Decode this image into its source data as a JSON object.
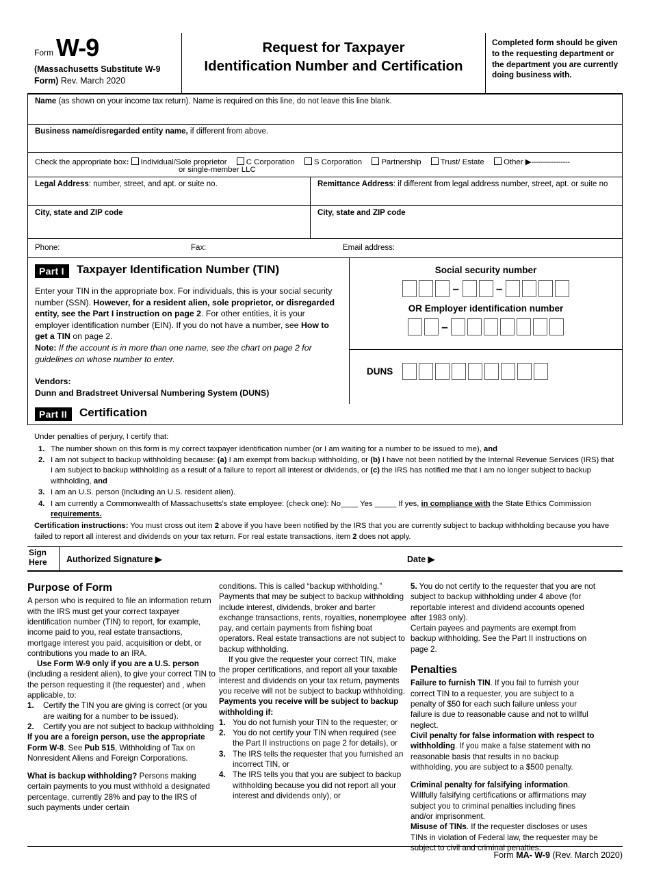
{
  "header": {
    "form_label": "Form",
    "form_number": "W-9",
    "substitute_line1": "(Massachusetts Substitute W-9",
    "substitute_line2_bold": "Form)",
    "substitute_line2_rest": " Rev. March 2020",
    "title_line1": "Request for Taxpayer",
    "title_line2": "Identification Number and Certification",
    "notice": "Completed form should be given to the requesting department or the department you are currently doing business with."
  },
  "fields": {
    "name_label_bold": "Name",
    "name_label_rest": " (as shown on your income tax return). Name is required on this line, do not leave this line blank.",
    "business_label_bold": "Business name/disregarded entity name,",
    "business_label_rest": " if different from above.",
    "checkbox_prompt": "Check the appropriate box",
    "checkbox_colon": ":",
    "options": [
      "Individual/Sole proprietor",
      "C Corporation",
      "S Corporation",
      "Partnership",
      "Trust/ Estate",
      "Other"
    ],
    "option_sub": "or single-member LLC",
    "other_arrow": "▶",
    "other_dashes": "-----------------",
    "legal_address_bold": "Legal Address",
    "legal_address_rest": ": number, street, and apt. or suite no.",
    "remittance_address_bold": "Remittance Address",
    "remittance_address_rest": ": if different from legal address number, street, apt. or suite no",
    "city_state_zip": "City, state and ZIP code",
    "phone": "Phone:",
    "fax": "Fax:",
    "email": "Email address:"
  },
  "part1": {
    "badge": "Part I",
    "heading": "Taxpayer Identification Number (TIN)",
    "p_a": "Enter your TIN in the appropriate box.  For individuals, this is your social security number (SSN).  ",
    "p_b_bold": "However, for a resident alien, sole proprietor, or disregarded entity, see the Part I instruction on page 2",
    "p_c": ".  For other entities, it is your employer identification number (EIN). If you do not have a number, see ",
    "p_d_bold": "How to get a TIN",
    "p_e": " on page 2.",
    "note_bold": "Note:",
    "note_italic": " If the account is in more than one name, see the chart on page 2 for guidelines on whose number to enter.",
    "vendors_line1": "Vendors:",
    "vendors_line2": "Dunn and Bradstreet Universal Numbering System (DUNS)",
    "ssn_label": "Social security number",
    "ein_label": "OR Employer identification number",
    "duns_label": "DUNS",
    "ssn_groups": [
      3,
      2,
      4
    ],
    "ein_groups": [
      2,
      7
    ],
    "duns_boxes": 9,
    "separator": "–"
  },
  "part2": {
    "badge": "Part II",
    "heading": "Certification",
    "lead": "Under penalties of perjury, I certify that:",
    "items": [
      {
        "num": "1.",
        "segments": [
          {
            "t": "The number shown on this form is my correct taxpayer identification number (or I am waiting for a number to be issued to me), ",
            "s": "n"
          },
          {
            "t": "and",
            "s": "b"
          }
        ]
      },
      {
        "num": "2.",
        "segments": [
          {
            "t": "I am not subject to backup withholding because: ",
            "s": "n"
          },
          {
            "t": "(a)",
            "s": "b"
          },
          {
            "t": " I am exempt from backup withholding, or ",
            "s": "n"
          },
          {
            "t": "(b)",
            "s": "b"
          },
          {
            "t": " I have not been notified by the Internal Revenue Services (IRS) that I am subject to backup withholding as a result of a failure to report all interest or dividends, or ",
            "s": "n"
          },
          {
            "t": "(c)",
            "s": "b"
          },
          {
            "t": " the IRS has notified me that I am no longer subject to backup withholding, ",
            "s": "n"
          },
          {
            "t": "and",
            "s": "b"
          }
        ]
      },
      {
        "num": "3.",
        "segments": [
          {
            "t": "I am an U.S. person (including an U.S. resident alien).",
            "s": "n"
          }
        ]
      },
      {
        "num": "4.",
        "segments": [
          {
            "t": "I am currently a Commonwealth of Massachusetts's state employee: (check one):  No____ Yes _____ If yes, ",
            "s": "n"
          },
          {
            "t": "in compliance with",
            "s": "bu"
          },
          {
            "t": " the State Ethics Commission ",
            "s": "n"
          },
          {
            "t": "requirements.",
            "s": "bu"
          }
        ]
      }
    ],
    "instructions_bold": "Certification instructions:",
    "instructions_rest_1": "  You must cross out item ",
    "instructions_two": "2",
    "instructions_rest_2": " above if you have been notified by the IRS that you are currently subject to backup withholding because you have failed to report all interest and dividends on your tax return.  For real estate transactions, item ",
    "instructions_two_b": "2",
    "instructions_rest_3": " does not apply.",
    "sign_here_l1": "Sign",
    "sign_here_l2": "Here",
    "signature_label": "Authorized Signature ▶",
    "date_label": "Date ▶"
  },
  "instructions": {
    "col1": {
      "title": "Purpose of Form",
      "p1": "A person who is required to file an information return with the IRS must get your correct taxpayer identification number (TIN) to report, for example, income paid to you, real estate transactions, mortgage interest you paid, acquisition or debt, or contributions you made to an IRA.",
      "p2_bold": "Use Form W-9 only if you are a U.S. person",
      "p2_rest": " (including a resident alien), to give your correct TIN to the person requesting it (the requester) and , when applicable, to:",
      "list": [
        {
          "num": "1.",
          "text": "Certify the TIN you are giving is correct (or you are waiting for a number to be issued)."
        },
        {
          "num": "2.",
          "text": "Certify you are not subject to backup withholding"
        }
      ],
      "p3_bold": "If you are a foreign person, use the appropriate Form W-8",
      "p3_mid": ".  See ",
      "p3_bold2": "Pub 515",
      "p3_rest": ", Withholding of Tax on Nonresident Aliens and Foreign Corporations.",
      "p4_bold": "What is backup withholding?",
      "p4_rest": " Persons making certain payments to you must withhold a designated percentage, currently 28% and pay to the IRS of such payments under certain"
    },
    "col2": {
      "p1": "conditions.  This is called “backup withholding.” Payments that may be subject to backup withholding include interest, dividends, broker and barter exchange transactions, rents, royalties, nonemployee pay, and certain payments from fishing boat operators.  Real estate transactions are not subject to backup withholding.",
      "p2": "If you give the requester your correct TIN, make the proper certifications, and report all your taxable interest and dividends on your tax return, payments you receive will not be subject to backup withholding. ",
      "p2_bold": "Payments you receive will be subject to backup withholding if:",
      "list": [
        {
          "num": "1.",
          "text": "You do not furnish your TIN to the  requester, or"
        },
        {
          "num": "2.",
          "text": "You do not certify your TIN when required (see the Part II instructions on page 2 for details), or"
        },
        {
          "num": "3.",
          "text": "The IRS tells the requester that you furnished an incorrect TIN, or"
        },
        {
          "num": "4.",
          "text": "The IRS tells you that you are subject to backup withholding because you did not report all your interest and dividends only), or"
        }
      ]
    },
    "col3": {
      "p1_bold": "5.",
      "p1_rest": " You do not certify to the requester that you are not subject to backup withholding under 4 above (for reportable interest and dividend accounts opened after 1983 only).",
      "p2": "Certain payees and payments are exempt from backup withholding.  See the Part II instructions on page 2.",
      "title": "Penalties",
      "p3_bold": "Failure to furnish TIN",
      "p3_rest": ".  If you fail to furnish your correct TIN to a requester, you are subject to a penalty of $50 for each such failure unless your failure is due to reasonable cause and not to willful neglect.",
      "p4_bold": "Civil penalty for false information with respect to withholding",
      "p4_rest": ".  If you make a false statement with no reasonable basis that results in no backup withholding, you are subject to a $500 penalty.",
      "p5_bold": "Criminal penalty for falsifying information",
      "p5_rest": ". Willfully falsifying certifications or affirmations may subject you to criminal penalties including fines and/or imprisonment.",
      "p6_bold": "Misuse of TINs",
      "p6_rest": ".  If the requester discloses or uses TINs in violation of Federal law, the requester may be subject to civil and criminal penalties."
    }
  },
  "footer": {
    "prefix": "Form ",
    "bold": "MA- W-9",
    "suffix": " (Rev. March 2020)"
  }
}
